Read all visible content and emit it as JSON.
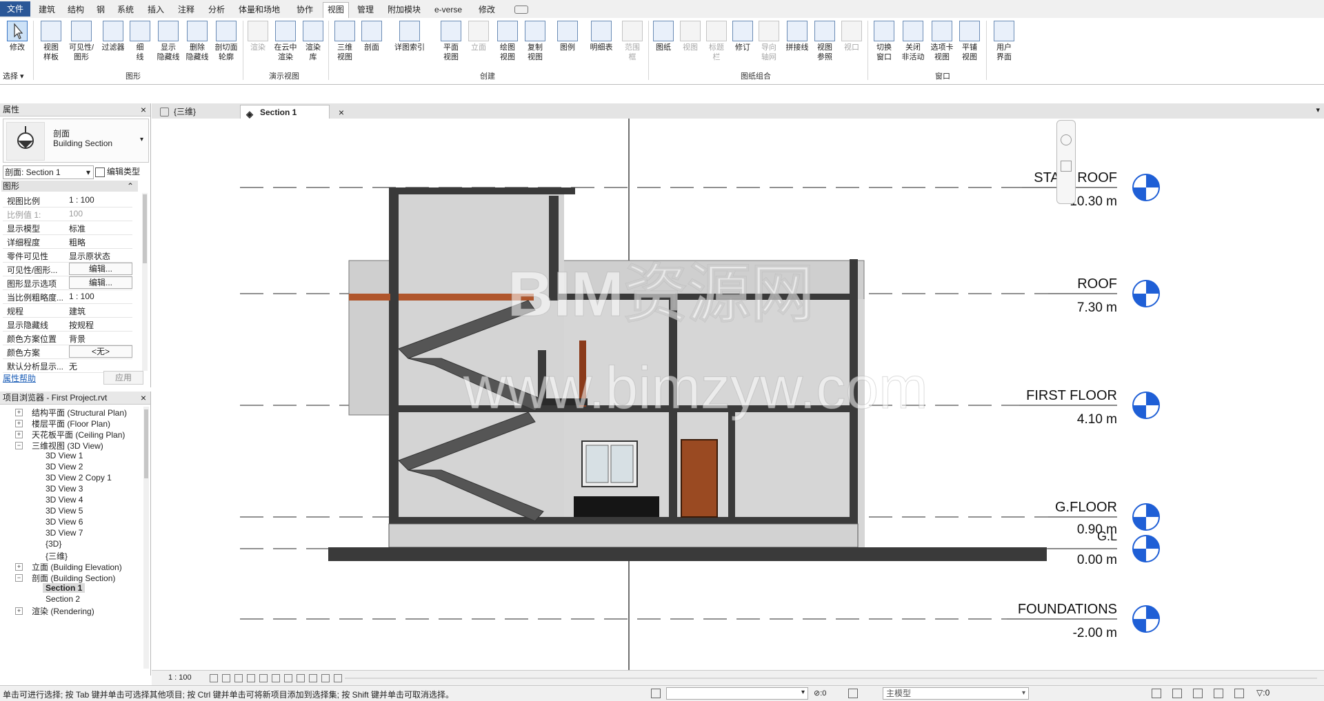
{
  "ribbon_tabs": [
    "文件",
    "建筑",
    "结构",
    "钢",
    "系统",
    "插入",
    "注释",
    "分析",
    "体量和场地",
    "协作",
    "视图",
    "管理",
    "附加模块",
    "e-verse",
    "修改"
  ],
  "ribbon": {
    "select_label": "选择",
    "panels": {
      "graphics": "图形",
      "presentation": "演示视图",
      "create": "创建",
      "sheet_composition": "图纸组合",
      "window": "窗口"
    },
    "buttons": [
      {
        "l1": "修改",
        "l2": "",
        "icon": "modify-cursor-icon"
      },
      {
        "l1": "视图",
        "l2": "样板",
        "icon": "view-template-icon"
      },
      {
        "l1": "可见性/",
        "l2": "图形",
        "icon": "visibility-graphics-icon"
      },
      {
        "l1": "过滤器",
        "l2": "",
        "icon": "filter-icon"
      },
      {
        "l1": "细",
        "l2": "线",
        "icon": "thin-lines-icon"
      },
      {
        "l1": "显示",
        "l2": "隐藏线",
        "icon": "show-hidden-lines-icon"
      },
      {
        "l1": "删除",
        "l2": "隐藏线",
        "icon": "remove-hidden-lines-icon"
      },
      {
        "l1": "剖切面",
        "l2": "轮廓",
        "icon": "cut-profile-icon"
      },
      {
        "l1": "渲染",
        "l2": "",
        "icon": "render-icon"
      },
      {
        "l1": "在云中",
        "l2": "渲染",
        "icon": "cloud-render-icon"
      },
      {
        "l1": "渲染",
        "l2": "库",
        "icon": "render-gallery-icon"
      },
      {
        "l1": "三维",
        "l2": "视图",
        "icon": "3d-view-icon"
      },
      {
        "l1": "剖面",
        "l2": "",
        "icon": "section-icon"
      },
      {
        "l1": "详图索引",
        "l2": "",
        "icon": "callout-icon"
      },
      {
        "l1": "平面",
        "l2": "视图",
        "icon": "plan-view-icon"
      },
      {
        "l1": "立面",
        "l2": "",
        "icon": "elevation-icon"
      },
      {
        "l1": "绘图",
        "l2": "视图",
        "icon": "drafting-view-icon"
      },
      {
        "l1": "复制",
        "l2": "视图",
        "icon": "duplicate-view-icon"
      },
      {
        "l1": "图例",
        "l2": "",
        "icon": "legend-icon"
      },
      {
        "l1": "明细表",
        "l2": "",
        "icon": "schedule-icon"
      },
      {
        "l1": "范围",
        "l2": "框",
        "icon": "scope-box-icon"
      },
      {
        "l1": "图纸",
        "l2": "",
        "icon": "sheet-icon"
      },
      {
        "l1": "视图",
        "l2": "",
        "icon": "place-view-icon"
      },
      {
        "l1": "标题",
        "l2": "栏",
        "icon": "title-block-icon"
      },
      {
        "l1": "修订",
        "l2": "",
        "icon": "revisions-icon"
      },
      {
        "l1": "导向",
        "l2": "轴网",
        "icon": "guide-grid-icon"
      },
      {
        "l1": "拼接线",
        "l2": "",
        "icon": "matchline-icon"
      },
      {
        "l1": "视图",
        "l2": "参照",
        "icon": "view-reference-icon"
      },
      {
        "l1": "视口",
        "l2": "",
        "icon": "viewport-icon"
      },
      {
        "l1": "切换",
        "l2": "窗口",
        "icon": "switch-windows-icon"
      },
      {
        "l1": "关闭",
        "l2": "非活动",
        "icon": "close-inactive-icon"
      },
      {
        "l1": "选项卡",
        "l2": "视图",
        "icon": "tab-views-icon"
      },
      {
        "l1": "平铺",
        "l2": "视图",
        "icon": "tile-views-icon"
      },
      {
        "l1": "用户",
        "l2": "界面",
        "icon": "user-interface-icon"
      }
    ]
  },
  "properties": {
    "title": "属性",
    "type_line1": "剖面",
    "type_line2": "Building Section",
    "instance_selector": "剖面: Section 1",
    "edit_type": "编辑类型",
    "group": "图形",
    "rows": [
      {
        "k": "视图比例",
        "v": "1 : 100"
      },
      {
        "k": "比例值 1:",
        "v": "100"
      },
      {
        "k": "显示模型",
        "v": "标准"
      },
      {
        "k": "详细程度",
        "v": "粗略"
      },
      {
        "k": "零件可见性",
        "v": "显示原状态"
      },
      {
        "k": "可见性/图形...",
        "v": "编辑..."
      },
      {
        "k": "图形显示选项",
        "v": "编辑..."
      },
      {
        "k": "当比例粗略度...",
        "v": "1 : 100"
      },
      {
        "k": "规程",
        "v": "建筑"
      },
      {
        "k": "显示隐藏线",
        "v": "按规程"
      },
      {
        "k": "颜色方案位置",
        "v": "背景"
      },
      {
        "k": "颜色方案",
        "v": "<无>"
      },
      {
        "k": "默认分析显示...",
        "v": "无"
      }
    ],
    "help": "属性帮助",
    "apply": "应用"
  },
  "browser": {
    "title": "项目浏览器 - First Project.rvt",
    "items": [
      {
        "t": "结构平面 (Structural Plan)",
        "lvl": 1,
        "exp": "+"
      },
      {
        "t": "楼层平面 (Floor Plan)",
        "lvl": 1,
        "exp": "+"
      },
      {
        "t": "天花板平面 (Ceiling Plan)",
        "lvl": 1,
        "exp": "+"
      },
      {
        "t": "三维视图 (3D View)",
        "lvl": 1,
        "exp": "-"
      },
      {
        "t": "3D View 1",
        "lvl": 2,
        "exp": ""
      },
      {
        "t": "3D View 2",
        "lvl": 2,
        "exp": ""
      },
      {
        "t": "3D View 2 Copy 1",
        "lvl": 2,
        "exp": ""
      },
      {
        "t": "3D View 3",
        "lvl": 2,
        "exp": ""
      },
      {
        "t": "3D View 4",
        "lvl": 2,
        "exp": ""
      },
      {
        "t": "3D View 5",
        "lvl": 2,
        "exp": ""
      },
      {
        "t": "3D View 6",
        "lvl": 2,
        "exp": ""
      },
      {
        "t": "3D View 7",
        "lvl": 2,
        "exp": ""
      },
      {
        "t": "{3D}",
        "lvl": 2,
        "exp": ""
      },
      {
        "t": "{三维}",
        "lvl": 2,
        "exp": ""
      },
      {
        "t": "立面 (Building Elevation)",
        "lvl": 1,
        "exp": "+"
      },
      {
        "t": "剖面 (Building Section)",
        "lvl": 1,
        "exp": "-"
      },
      {
        "t": "Section 1",
        "lvl": 2,
        "exp": "",
        "bold": true
      },
      {
        "t": "Section 2",
        "lvl": 2,
        "exp": ""
      },
      {
        "t": "渲染 (Rendering)",
        "lvl": 1,
        "exp": "+"
      }
    ]
  },
  "view_tabs": [
    {
      "label": "{三维}",
      "active": false
    },
    {
      "label": "Section 1",
      "active": true
    }
  ],
  "levels": [
    {
      "name": "STAIR ROOF",
      "elev": "10.30 m"
    },
    {
      "name": "ROOF",
      "elev": "7.30 m"
    },
    {
      "name": "FIRST FLOOR",
      "elev": "4.10 m"
    },
    {
      "name": "G.FLOOR",
      "elev": "0.90 m"
    },
    {
      "name": "G.L",
      "elev": "0.00 m"
    },
    {
      "name": "FOUNDATIONS",
      "elev": "-2.00 m"
    }
  ],
  "watermark": {
    "line1": "BIM资源网",
    "line2": "www.bimzyw.com"
  },
  "view_control": {
    "scale": "1 : 100"
  },
  "status": {
    "message": "单击可进行选择; 按 Tab 键并单击可选择其他项目; 按 Ctrl 键并单击可将新项目添加到选择集; 按 Shift 键并单击可取消选择。",
    "worksets_count": ":0",
    "design_option": "主模型",
    "filter_count": ":0"
  },
  "colors": {
    "accent": "#2b5797",
    "level_blue": "#1f5fd6",
    "wall": "#3a3a3a",
    "section_fill": "#cfcfcf",
    "beam": "#b0562c",
    "door": "#9a4a22"
  }
}
